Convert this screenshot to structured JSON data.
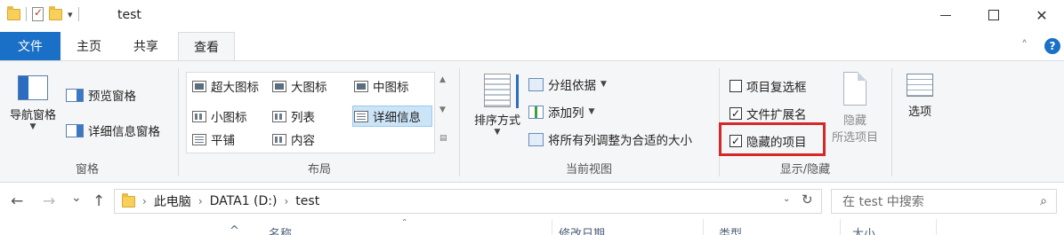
{
  "window": {
    "title": "test",
    "qat_arrow": "▾",
    "controls": {
      "minimize": "",
      "maximize": "",
      "close": "✕"
    }
  },
  "tabs": [
    {
      "label": "文件",
      "active": false
    },
    {
      "label": "主页",
      "active": false
    },
    {
      "label": "共享",
      "active": false
    },
    {
      "label": "查看",
      "active": true
    }
  ],
  "ribbon_extras": {
    "collapse": "˄",
    "help": "?"
  },
  "ribbon": {
    "panes": {
      "label": "窗格",
      "nav_pane": "导航窗格",
      "preview_pane": "预览窗格",
      "details_pane": "详细信息窗格"
    },
    "layout": {
      "label": "布局",
      "options": [
        "超大图标",
        "大图标",
        "中图标",
        "小图标",
        "列表",
        "详细信息",
        "平铺",
        "内容"
      ],
      "selected": "详细信息"
    },
    "current_view": {
      "label": "当前视图",
      "sort_by": "排序方式",
      "group_by": "分组依据",
      "add_columns": "添加列",
      "size_all_columns": "将所有列调整为合适的大小"
    },
    "show_hide": {
      "label": "显示/隐藏",
      "item_checkboxes": {
        "label": "项目复选框",
        "checked": false
      },
      "file_extensions": {
        "label": "文件扩展名",
        "checked": true
      },
      "hidden_items": {
        "label": "隐藏的项目",
        "checked": true
      },
      "hide_selected": {
        "line1": "隐藏",
        "line2": "所选项目"
      },
      "check_mark": "✓"
    },
    "options": {
      "label": "选项"
    }
  },
  "address_bar": {
    "back": "←",
    "forward": "→",
    "recent": "⌄",
    "up": "↑",
    "crumbs": [
      "此电脑",
      "DATA1 (D:)",
      "test"
    ],
    "separator": "›",
    "dropdown": "⌄",
    "refresh": "↻"
  },
  "search": {
    "placeholder": "在 test 中搜索",
    "icon": "⌕"
  },
  "columns": {
    "sort_arrow": "˄",
    "headers": [
      "名称",
      "修改日期",
      "类型",
      "大小"
    ]
  },
  "colors": {
    "accent": "#1a6fc6",
    "ribbon_bg": "#f5f6f7",
    "highlight_border": "#d62828",
    "selection": "#cce4f7"
  }
}
